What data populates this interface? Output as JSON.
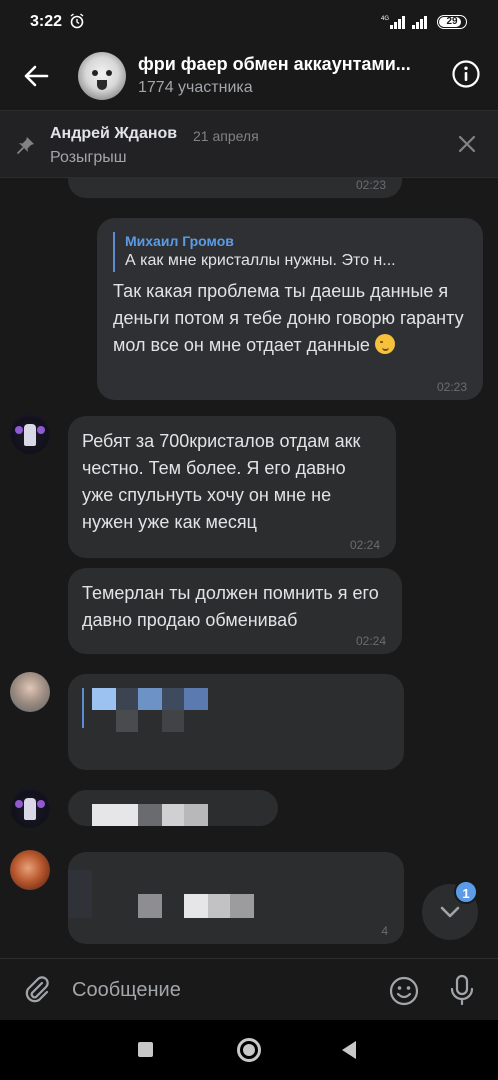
{
  "status_bar": {
    "time": "3:22",
    "battery": "29",
    "network": "4G"
  },
  "header": {
    "title": "фри фаер обмен аккаунтами...",
    "subtitle": "1774 участника"
  },
  "pinned": {
    "author": "Андрей Жданов",
    "date": "21 апреля",
    "text": "Розыгрыш"
  },
  "messages": [
    {
      "time": "02:23"
    },
    {
      "reply": {
        "author": "Михаил Громов",
        "text": "А как мне кристаллы нужны.    Это н..."
      },
      "text": "Так какая проблема ты даешь данные я деньги потом я тебе доню говорю гаранту мол все он мне отдает данные",
      "emoji": "wink-emoji",
      "time": "02:23"
    },
    {
      "text": "Ребят за 700кристалов    отдам акк честно. Тем более.  Я его давно уже спульнуть хочу он мне не нужен уже как месяц",
      "time": "02:24"
    },
    {
      "text": "Темерлан ты должен помнить я его давно продаю обмениваб",
      "time": "02:24"
    },
    {
      "time": "4"
    }
  ],
  "scroll_badge": "1",
  "composer": {
    "placeholder": "Сообщение"
  },
  "colors": {
    "accent": "#5c9ce6",
    "background": "#19191a",
    "bubble": "#2c2d2e"
  }
}
